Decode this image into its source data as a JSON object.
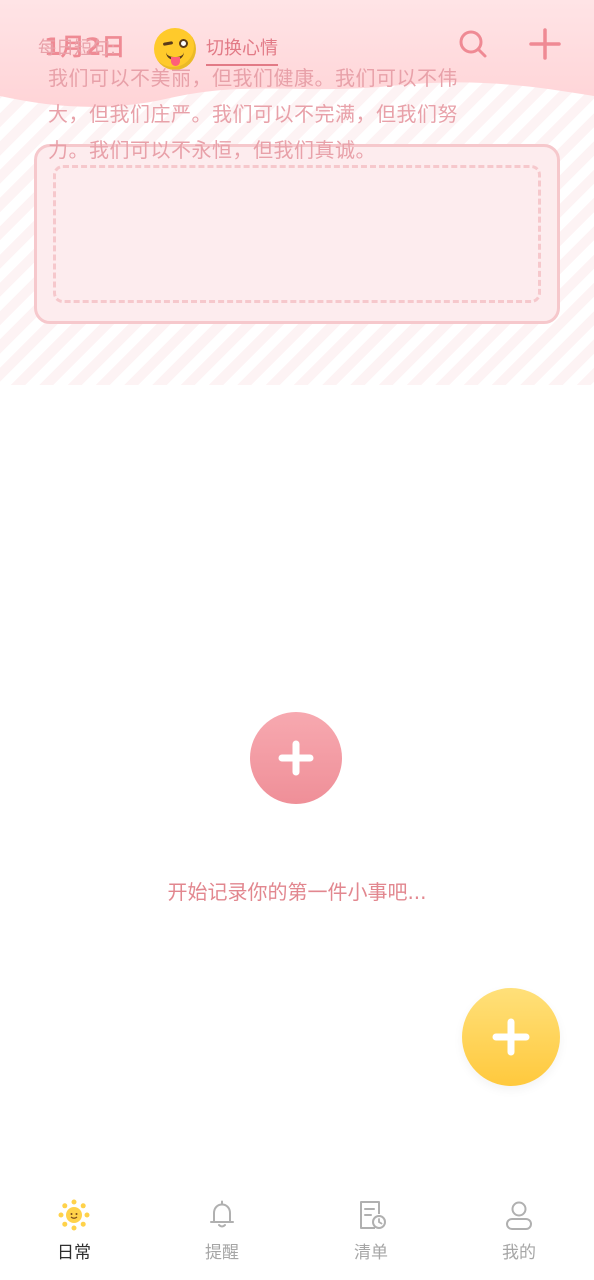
{
  "header": {
    "date": "1月2日",
    "mood_switch_label": "切换心情"
  },
  "quote": {
    "title": "每日短句:",
    "text": "我们可以不美丽，但我们健康。我们可以不伟大，但我们庄严。我们可以不完满，但我们努力。我们可以不永恒，但我们真诚。"
  },
  "empty_state": {
    "hint": "开始记录你的第一件小事吧..."
  },
  "nav": {
    "items": [
      {
        "label": "日常",
        "icon": "sun-icon",
        "active": true
      },
      {
        "label": "提醒",
        "icon": "bell-icon",
        "active": false
      },
      {
        "label": "清单",
        "icon": "checklist-clock-icon",
        "active": false
      },
      {
        "label": "我的",
        "icon": "user-icon",
        "active": false
      }
    ]
  },
  "colors": {
    "accent_pink": "#ef8f98",
    "accent_yellow": "#ffc93d",
    "text_pink": "#e8a1a9",
    "nav_inactive": "#a6a6a6",
    "nav_active": "#2f2f2f"
  }
}
